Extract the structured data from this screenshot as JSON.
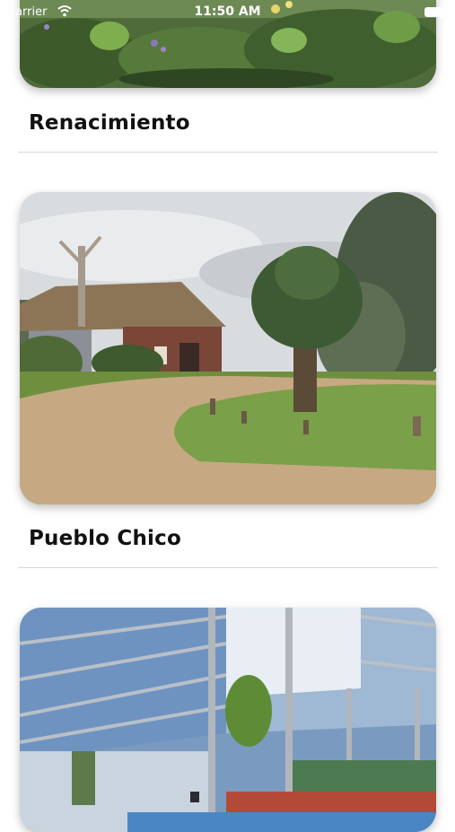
{
  "status_bar": {
    "carrier": "Carrier",
    "time": "11:50 AM"
  },
  "places": [
    {
      "name": "Renacimiento",
      "image_icon": "garden-photo"
    },
    {
      "name": "Pueblo Chico",
      "image_icon": "ranch-photo"
    },
    {
      "name": "",
      "image_icon": "indoor-pool-photo"
    }
  ]
}
